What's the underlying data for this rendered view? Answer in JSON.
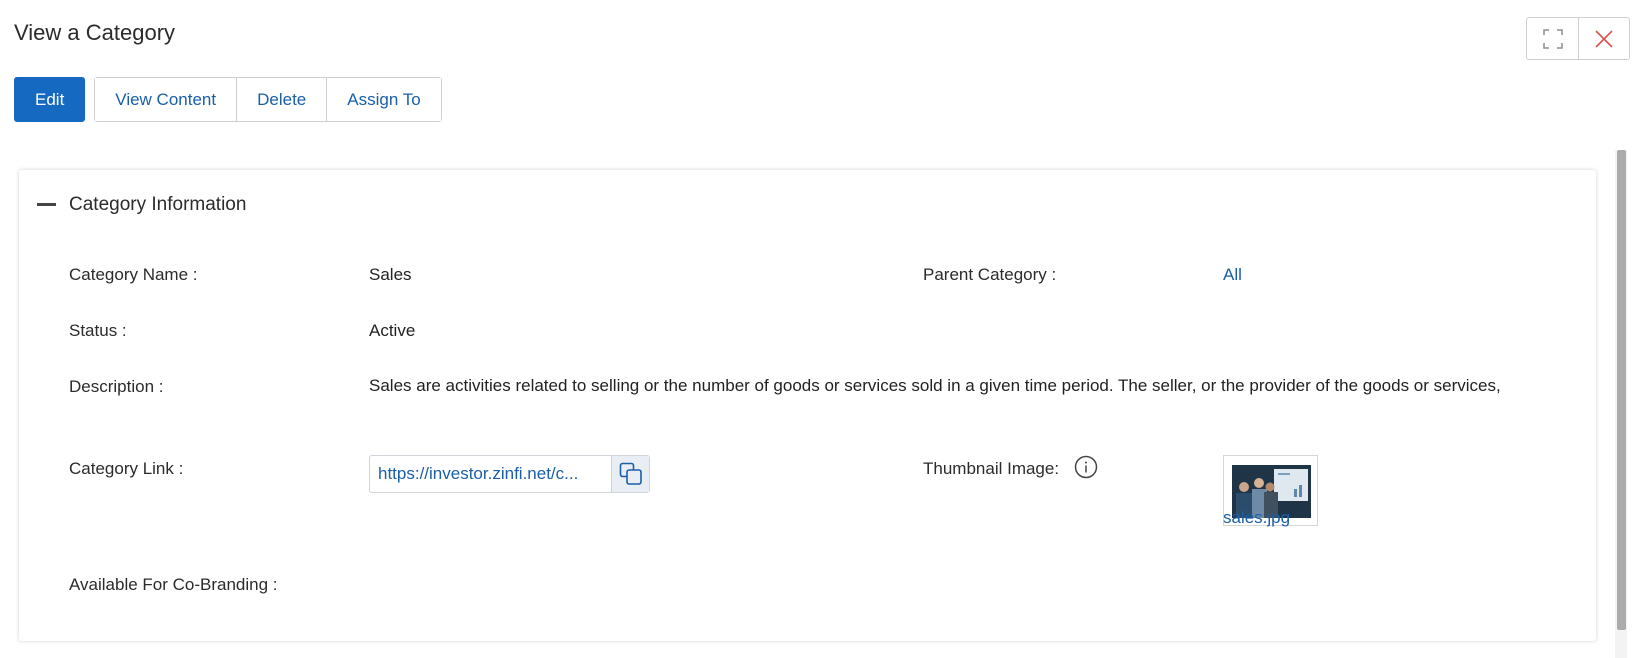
{
  "page": {
    "title": "View a Category"
  },
  "window_controls": {
    "expand_icon": "expand-icon",
    "close_icon": "close-icon",
    "close_color": "#d9534f"
  },
  "toolbar": {
    "edit_label": "Edit",
    "view_content_label": "View Content",
    "delete_label": "Delete",
    "assign_to_label": "Assign To"
  },
  "colors": {
    "primary": "#1669c0",
    "link": "#1a5fa8"
  },
  "section": {
    "title": "Category Information",
    "collapse_icon": "minus-icon"
  },
  "fields": {
    "category_name": {
      "label": "Category Name :",
      "value": "Sales"
    },
    "parent_category": {
      "label": "Parent Category :",
      "value": "All"
    },
    "status": {
      "label": "Status :",
      "value": "Active"
    },
    "description": {
      "label": "Description :",
      "value": "Sales are activities related to selling or the number of goods or services sold in a given time period. The seller, or the provider of the goods or services,"
    },
    "category_link": {
      "label": "Category Link :",
      "value": "https://investor.zinfi.net/c...",
      "copy_icon": "copy-icon"
    },
    "thumbnail_image": {
      "label": "Thumbnail Image:",
      "info_icon": "info-icon",
      "file_name": "sales.jpg"
    },
    "co_branding": {
      "label": "Available For Co-Branding :"
    }
  }
}
